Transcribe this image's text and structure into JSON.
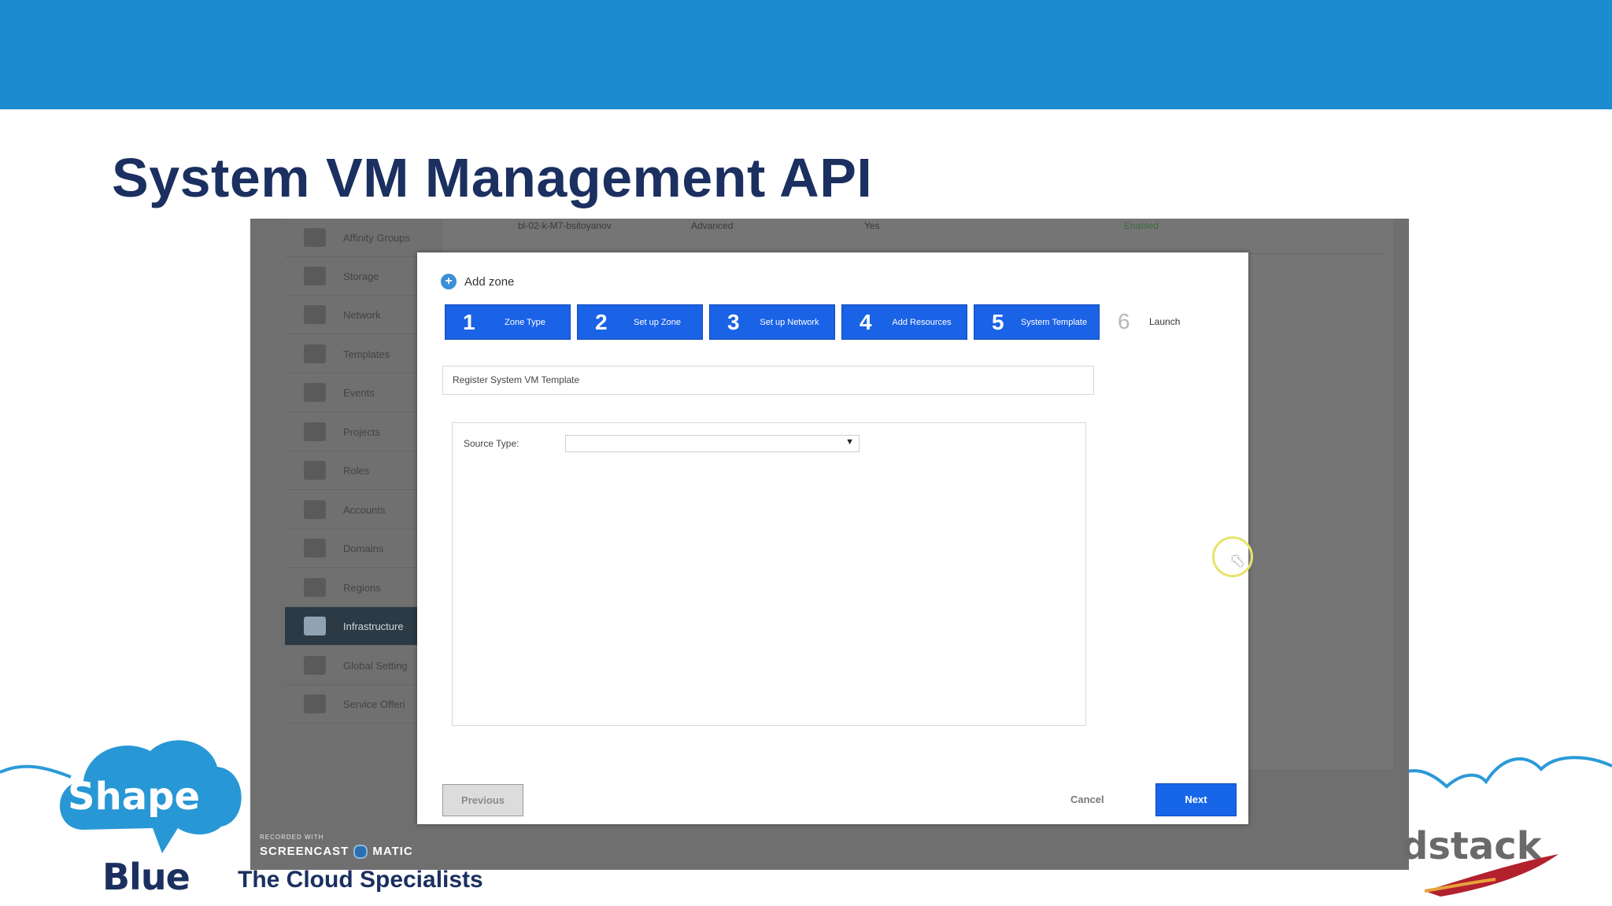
{
  "slide": {
    "title": "System VM Management API",
    "tagline": "The Cloud Specialists",
    "logo_shape": "Shape",
    "logo_blue": "Blue",
    "cloudstack_fragment": "dstack"
  },
  "recording": {
    "recorded_with": "RECORDED WITH",
    "brand_left": "SCREENCAST",
    "brand_right": "MATIC"
  },
  "sidebar": {
    "items": [
      {
        "label": "Affinity Groups",
        "icon": "affinity-groups-icon"
      },
      {
        "label": "Storage",
        "icon": "storage-icon"
      },
      {
        "label": "Network",
        "icon": "network-icon"
      },
      {
        "label": "Templates",
        "icon": "templates-icon"
      },
      {
        "label": "Events",
        "icon": "events-icon"
      },
      {
        "label": "Projects",
        "icon": "projects-icon"
      },
      {
        "label": "Roles",
        "icon": "roles-icon"
      },
      {
        "label": "Accounts",
        "icon": "accounts-icon"
      },
      {
        "label": "Domains",
        "icon": "domains-icon"
      },
      {
        "label": "Regions",
        "icon": "regions-icon"
      },
      {
        "label": "Infrastructure",
        "icon": "infrastructure-icon",
        "active": true
      },
      {
        "label": "Global Setting",
        "icon": "global-settings-icon"
      },
      {
        "label": "Service Offeri",
        "icon": "service-offerings-icon"
      }
    ]
  },
  "background_table": {
    "row1": {
      "name": "bl-02-k-M7-bsitoyanov",
      "type": "Advanced",
      "flag": "Yes",
      "status": "Enabled"
    }
  },
  "dialog": {
    "title": "Add zone",
    "steps": [
      {
        "num": "1",
        "label": "Zone Type"
      },
      {
        "num": "2",
        "label": "Set up Zone"
      },
      {
        "num": "3",
        "label": "Set up Network"
      },
      {
        "num": "4",
        "label": "Add Resources"
      },
      {
        "num": "5",
        "label": "System Template"
      },
      {
        "num": "6",
        "label": "Launch"
      }
    ],
    "section_header": "Register System VM Template",
    "source_type_label": "Source Type:",
    "source_type_value": "",
    "buttons": {
      "previous": "Previous",
      "cancel": "Cancel",
      "next": "Next"
    }
  },
  "colors": {
    "top_band": "#1c8bd0",
    "title": "#1b3060",
    "step_active": "#1a62e6",
    "next_button": "#1766e8"
  }
}
